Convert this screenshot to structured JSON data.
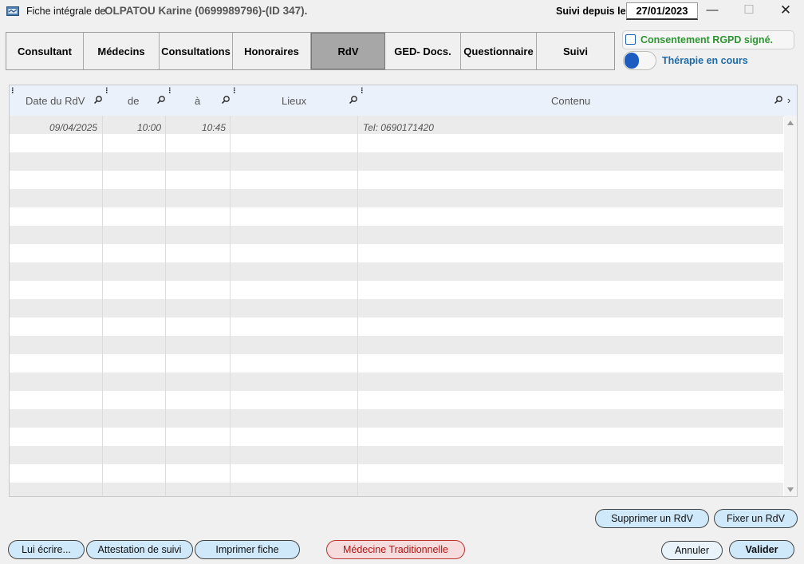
{
  "window": {
    "title_prefix": "Fiche intégrale de",
    "patient": "OLPATOU Karine (0699989796)-(ID 347).",
    "suivi_label": "Suivi depuis le",
    "suivi_date": "27/01/2023",
    "min_glyph": "—",
    "max_glyph": "☐",
    "close_glyph": "✕"
  },
  "tabs": [
    {
      "label": "Consultant"
    },
    {
      "label": "Médecins"
    },
    {
      "label": "Consultations"
    },
    {
      "label": "Honoraires"
    },
    {
      "label": "RdV",
      "active": true
    },
    {
      "label": "GED- Docs."
    },
    {
      "label": "Questionnaire"
    },
    {
      "label": "Suivi"
    }
  ],
  "options": {
    "rgpd_label": "Consentement RGPD signé.",
    "rgpd_checked": false,
    "therapy_label": "Thérapie en cours",
    "therapy_on": true
  },
  "table": {
    "columns": [
      "Date du RdV",
      "de",
      "à",
      "Lieux",
      "Contenu"
    ],
    "rows": [
      {
        "date": "09/04/2025",
        "de": "10:00",
        "a": "10:45",
        "lieux": "",
        "contenu": "Tel: 0690171420"
      }
    ]
  },
  "actions": {
    "supprimer": "Supprimer un RdV",
    "fixer": "Fixer un RdV",
    "lui_ecrire": "Lui écrire...",
    "attestation": "Attestation de suivi",
    "imprimer": "Imprimer fiche",
    "medecine": "Médecine Traditionnelle",
    "annuler": "Annuler",
    "valider": "Valider"
  },
  "colors": {
    "accent": "#1d5cc0",
    "rgpd_green": "#2d9530",
    "therapy_blue": "#1f6aa8",
    "button_blue": "#cfe8fa",
    "button_red": "#b01515"
  }
}
